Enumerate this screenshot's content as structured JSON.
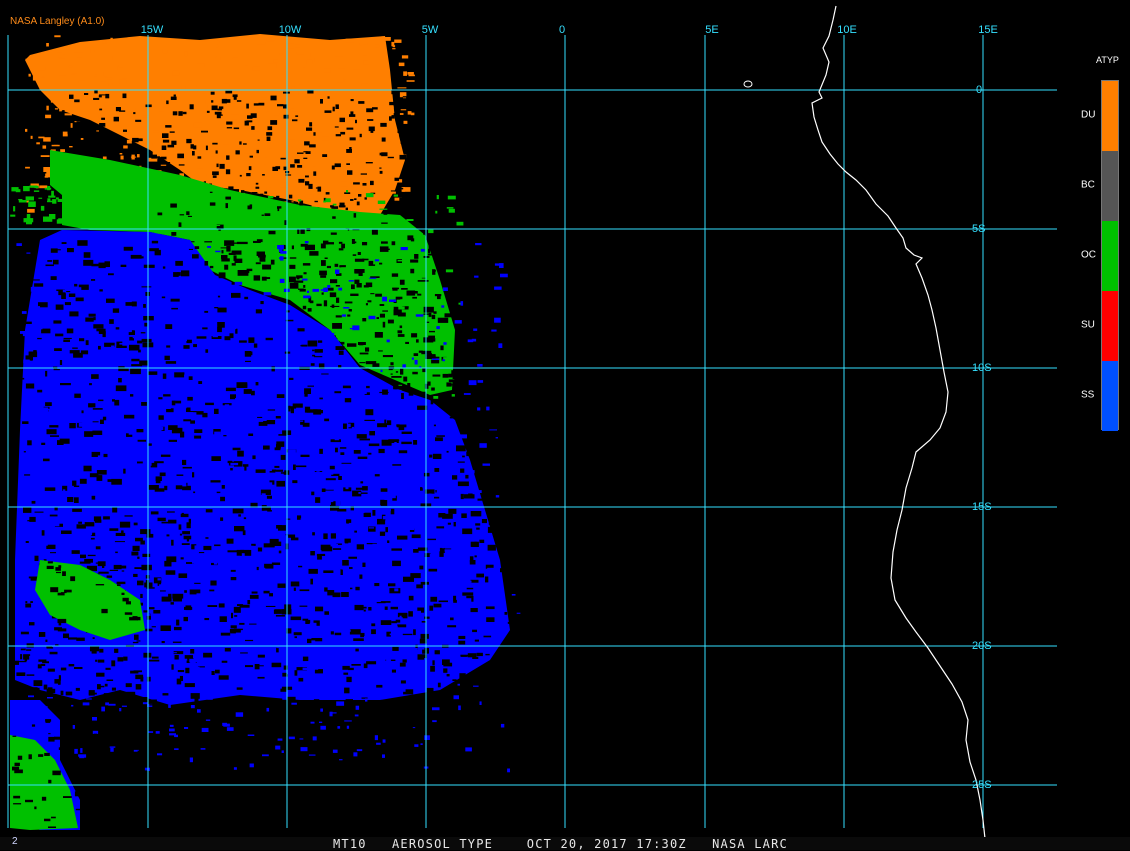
{
  "credit": "NASA Langley (A1.0)",
  "footer": "MT10   AEROSOL TYPE    OCT 20, 2017 17:30Z   NASA LARC",
  "footer_left": "2",
  "lon_labels": [
    "15W",
    "10W",
    "5W",
    "0",
    "5E",
    "10E",
    "15E"
  ],
  "lat_labels": [
    "0",
    "5S",
    "10S",
    "15S",
    "20S",
    "25S"
  ],
  "legend": {
    "title": "ATYP",
    "items": [
      {
        "code": "DU",
        "color": "#ff7f00"
      },
      {
        "code": "BC",
        "color": "#555555"
      },
      {
        "code": "OC",
        "color": "#00c000"
      },
      {
        "code": "SU",
        "color": "#ff0000"
      },
      {
        "code": "SS",
        "color": "#0050ff"
      }
    ]
  },
  "colors": {
    "grid": "#35e0ff",
    "coast": "#ffffff",
    "dust": "#ff7f00",
    "organic_carbon": "#00c000",
    "sea_salt_map": "#0000ff"
  }
}
